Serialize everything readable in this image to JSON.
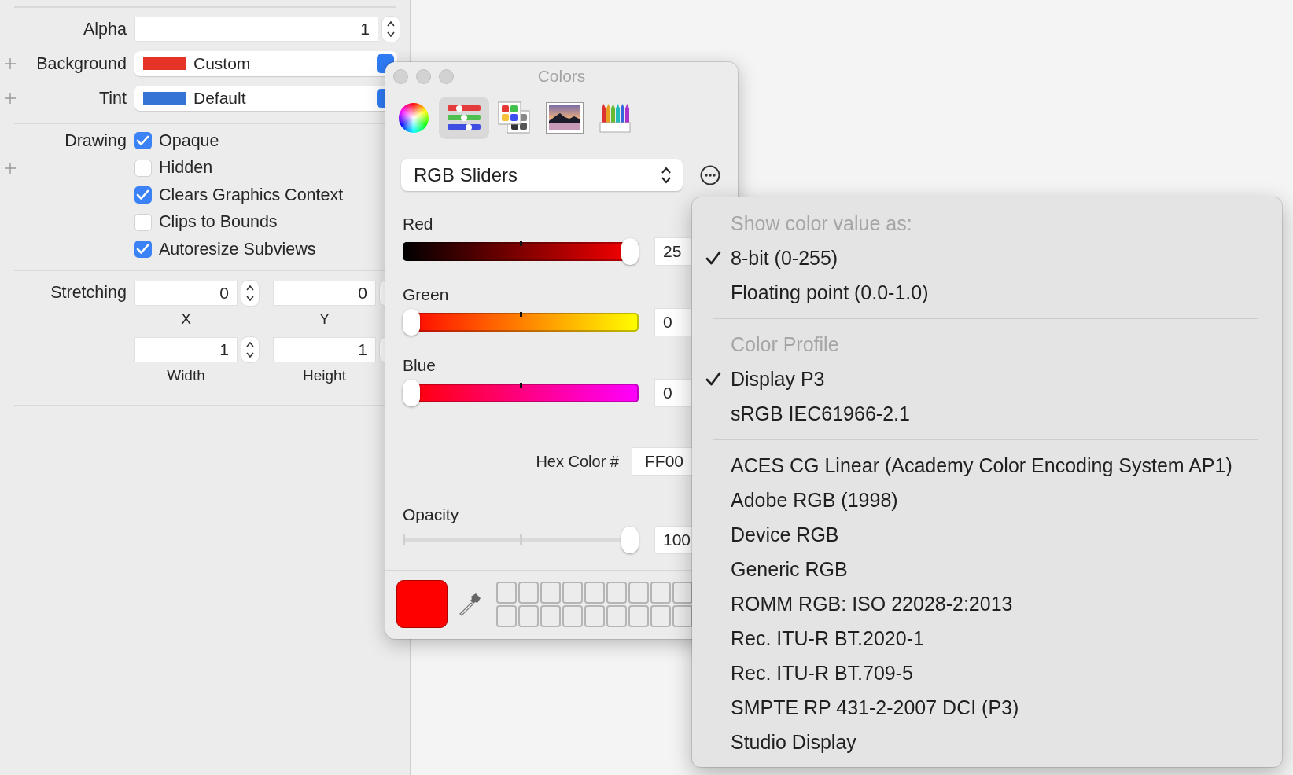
{
  "inspector": {
    "alpha": {
      "label": "Alpha",
      "value": "1"
    },
    "color_rows": [
      {
        "label": "Background",
        "value": "Custom",
        "color": "#e63327",
        "variations": true
      },
      {
        "label": "Tint",
        "value": "Default",
        "color": "#3574d4",
        "variations": true
      }
    ],
    "drawing": {
      "label": "Drawing",
      "options": [
        {
          "label": "Opaque",
          "checked": true,
          "variations": false
        },
        {
          "label": "Hidden",
          "checked": false,
          "variations": true
        },
        {
          "label": "Clears Graphics Context",
          "checked": true,
          "variations": false
        },
        {
          "label": "Clips to Bounds",
          "checked": false,
          "variations": false
        },
        {
          "label": "Autoresize Subviews",
          "checked": true,
          "variations": false
        }
      ]
    },
    "stretching": {
      "label": "Stretching",
      "fields": [
        {
          "value": "0",
          "caption": "X"
        },
        {
          "value": "0",
          "caption": "Y"
        },
        {
          "value": "1",
          "caption": "Width"
        },
        {
          "value": "1",
          "caption": "Height"
        }
      ]
    }
  },
  "colors_window": {
    "title": "Colors",
    "modes": [
      {
        "kind": "wheel",
        "selected": false
      },
      {
        "kind": "sliders",
        "selected": true
      },
      {
        "kind": "palettes",
        "selected": false
      },
      {
        "kind": "image",
        "selected": false
      },
      {
        "kind": "pencils",
        "selected": false
      }
    ],
    "mode_popup": "RGB Sliders",
    "channels": [
      {
        "name": "Red",
        "level": 1,
        "value": "25"
      },
      {
        "name": "Green",
        "level": 0,
        "value": "0"
      },
      {
        "name": "Blue",
        "level": 0,
        "value": "0"
      }
    ],
    "hex": {
      "label": "Hex Color #",
      "value": "FF00"
    },
    "opacity": {
      "label": "Opacity",
      "level": 1,
      "value": "100"
    },
    "color_well": {
      "color": "#ff0000"
    }
  },
  "menu": {
    "items": [
      {
        "kind": "header",
        "label": "Show color value as:"
      },
      {
        "kind": "option",
        "label": "8-bit (0-255)",
        "checked": true
      },
      {
        "kind": "option",
        "label": "Floating point (0.0-1.0)",
        "checked": false
      },
      {
        "kind": "separator"
      },
      {
        "kind": "header",
        "label": "Color Profile"
      },
      {
        "kind": "option",
        "label": "Display P3",
        "checked": true
      },
      {
        "kind": "option",
        "label": "sRGB IEC61966-2.1",
        "checked": false
      },
      {
        "kind": "separator"
      },
      {
        "kind": "option",
        "label": "ACES CG Linear (Academy Color Encoding System AP1)",
        "checked": false
      },
      {
        "kind": "option",
        "label": "Adobe RGB (1998)",
        "checked": false
      },
      {
        "kind": "option",
        "label": "Device RGB",
        "checked": false
      },
      {
        "kind": "option",
        "label": "Generic RGB",
        "checked": false
      },
      {
        "kind": "option",
        "label": "ROMM RGB: ISO 22028-2:2013",
        "checked": false
      },
      {
        "kind": "option",
        "label": "Rec. ITU-R BT.2020-1",
        "checked": false
      },
      {
        "kind": "option",
        "label": "Rec. ITU-R BT.709-5",
        "checked": false
      },
      {
        "kind": "option",
        "label": "SMPTE RP 431-2-2007 DCI (P3)",
        "checked": false
      },
      {
        "kind": "option",
        "label": "Studio Display",
        "checked": false
      }
    ]
  }
}
